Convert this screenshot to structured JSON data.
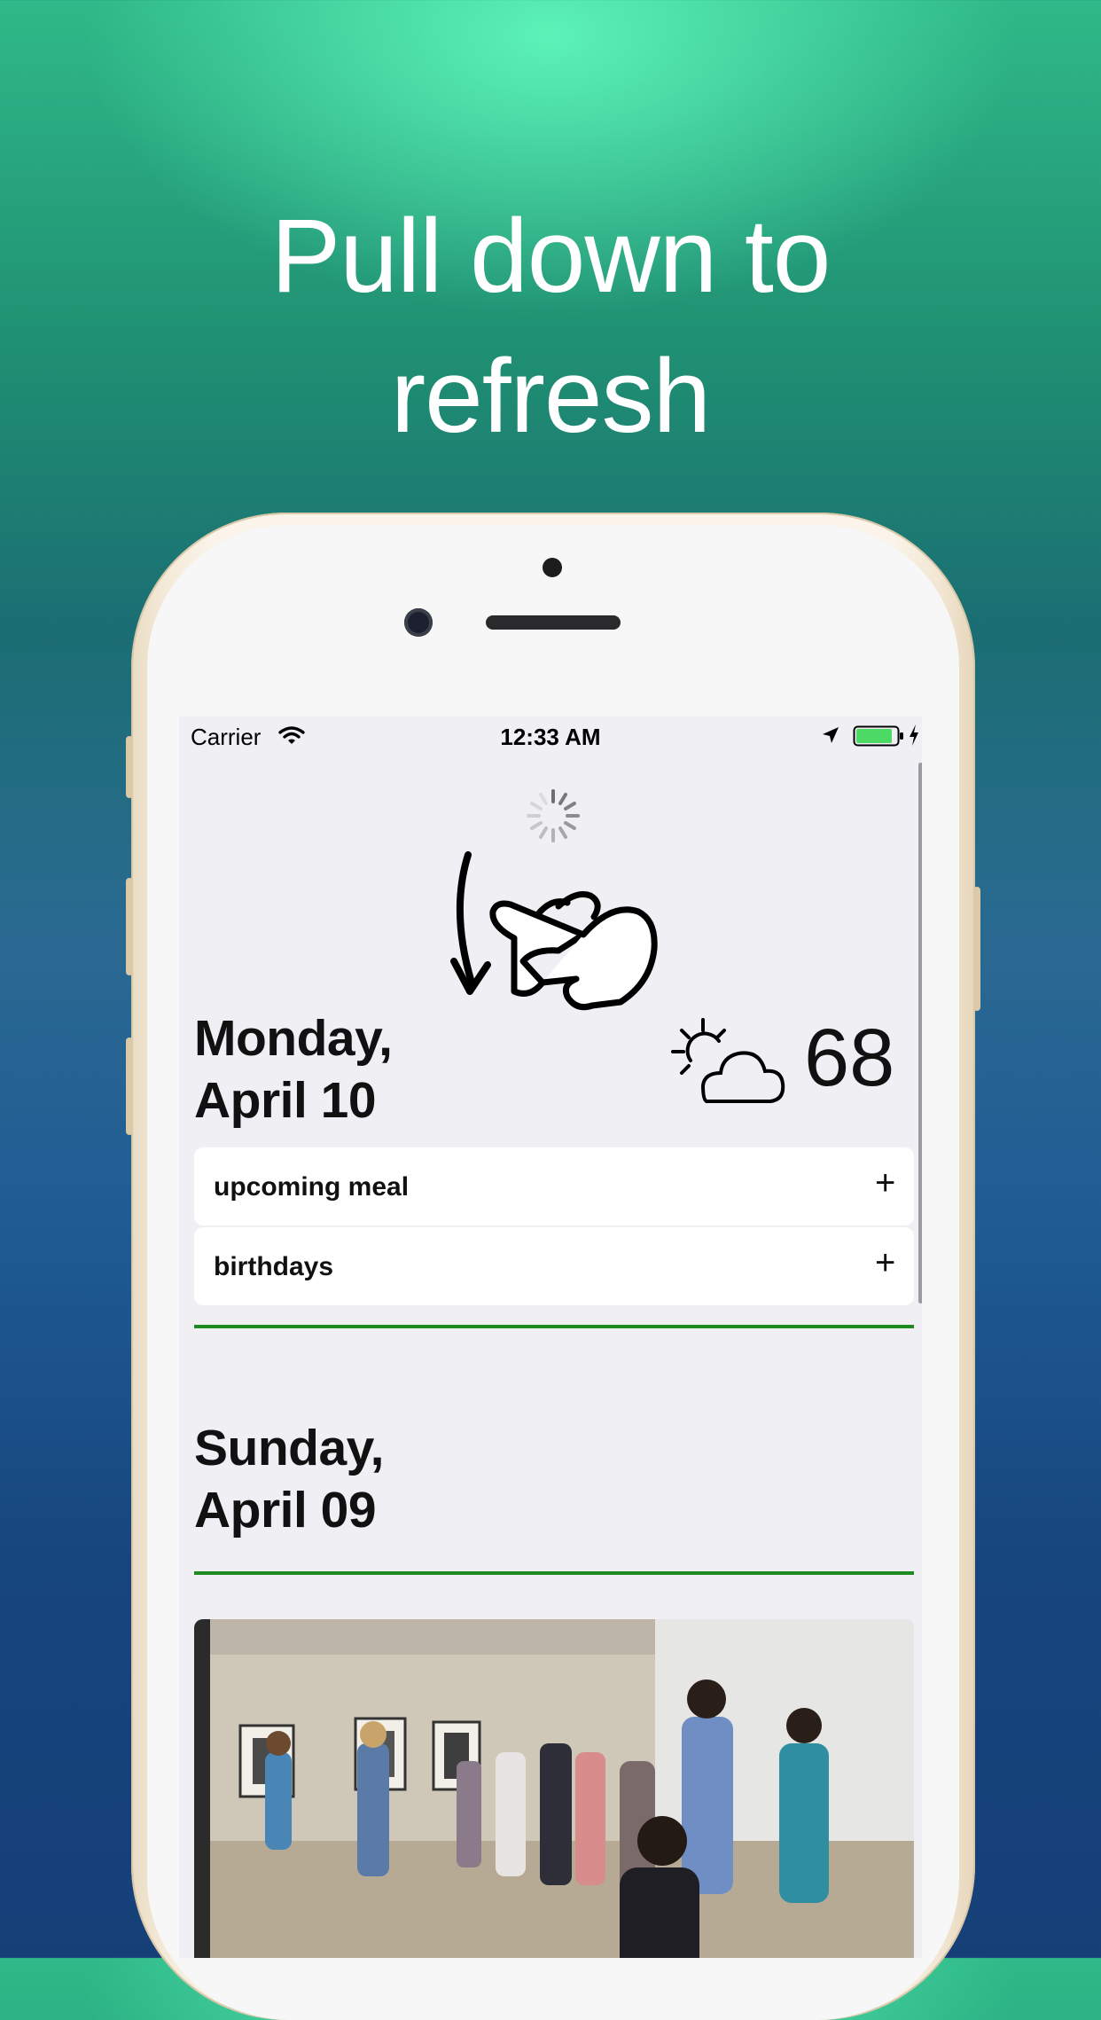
{
  "headline": {
    "line1": "Pull down to",
    "line2": "refresh"
  },
  "status_bar": {
    "carrier": "Carrier",
    "time": "12:33 AM"
  },
  "today": {
    "line1": "Monday,",
    "line2": "April 10"
  },
  "weather": {
    "temperature": "68",
    "icon": "partly-cloudy-icon"
  },
  "cards": [
    {
      "label": "upcoming meal",
      "action": "+"
    },
    {
      "label": "birthdays",
      "action": "+"
    }
  ],
  "previous_day": {
    "line1": "Sunday,",
    "line2": "April 09"
  },
  "colors": {
    "accent_green": "#1f8a1f",
    "battery_green": "#4cd964",
    "screen_background": "#efeff4",
    "card_background": "#ffffff"
  },
  "icons": [
    "wifi-icon",
    "location-arrow-icon",
    "battery-icon",
    "charging-bolt-icon",
    "loading-spinner-icon",
    "pull-down-hand-icon",
    "partly-cloudy-icon",
    "plus-icon"
  ]
}
